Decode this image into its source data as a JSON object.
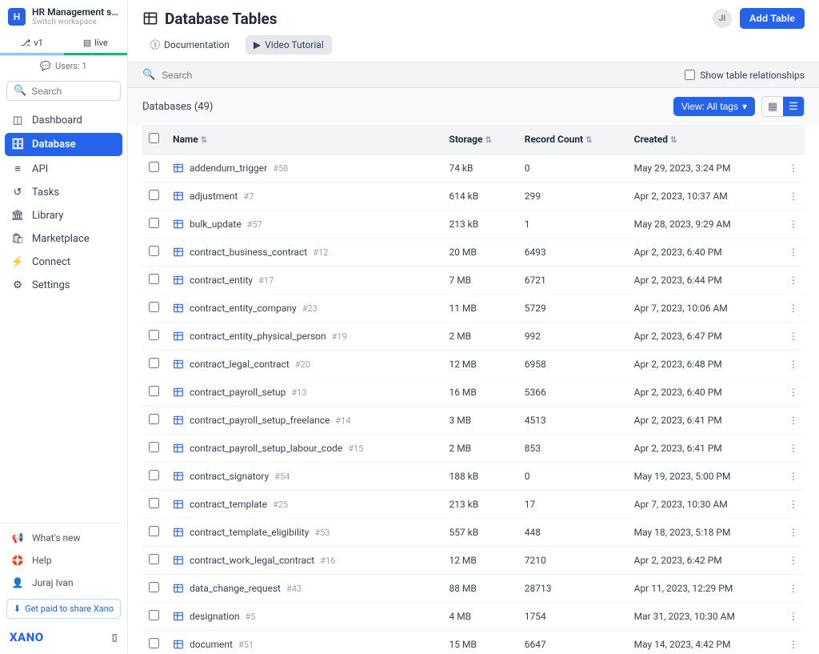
{
  "workspace": {
    "logo_letter": "H",
    "name": "HR Management sy...",
    "subtitle": "Switch workspace"
  },
  "env_tabs": {
    "v1": "v1",
    "live": "live"
  },
  "users_bar": "Users: 1",
  "sidebar_search_placeholder": "Search",
  "nav": {
    "dashboard": "Dashboard",
    "database": "Database",
    "api": "API",
    "tasks": "Tasks",
    "library": "Library",
    "marketplace": "Marketplace",
    "connect": "Connect",
    "settings": "Settings"
  },
  "bottom_nav": {
    "whatsnew": "What's new",
    "help": "Help",
    "user": "Juraj Ivan",
    "share": "Get paid to share Xano",
    "brand": "XANO"
  },
  "header": {
    "title": "Database Tables",
    "documentation": "Documentation",
    "video_tutorial": "Video Tutorial",
    "avatar": "JI",
    "add_table": "Add Table"
  },
  "searchbar": {
    "placeholder": "Search",
    "show_relationships": "Show table relationships"
  },
  "toolbar": {
    "count_label": "Databases (49)",
    "view_btn": "View: All tags"
  },
  "columns": {
    "name": "Name",
    "storage": "Storage",
    "record_count": "Record Count",
    "created": "Created"
  },
  "rows": [
    {
      "name": "addendum_trigger",
      "id": "#58",
      "storage": "74 kB",
      "records": "0",
      "created": "May 29, 2023, 3:24 PM"
    },
    {
      "name": "adjustment",
      "id": "#7",
      "storage": "614 kB",
      "records": "299",
      "created": "Apr 2, 2023, 10:37 AM"
    },
    {
      "name": "bulk_update",
      "id": "#57",
      "storage": "213 kB",
      "records": "1",
      "created": "May 28, 2023, 9:29 AM"
    },
    {
      "name": "contract_business_contract",
      "id": "#12",
      "storage": "20 MB",
      "records": "6493",
      "created": "Apr 2, 2023, 6:40 PM"
    },
    {
      "name": "contract_entity",
      "id": "#17",
      "storage": "7 MB",
      "records": "6721",
      "created": "Apr 2, 2023, 6:44 PM"
    },
    {
      "name": "contract_entity_company",
      "id": "#23",
      "storage": "11 MB",
      "records": "5729",
      "created": "Apr 7, 2023, 10:06 AM"
    },
    {
      "name": "contract_entity_physical_person",
      "id": "#19",
      "storage": "2 MB",
      "records": "992",
      "created": "Apr 2, 2023, 6:47 PM"
    },
    {
      "name": "contract_legal_contract",
      "id": "#20",
      "storage": "12 MB",
      "records": "6958",
      "created": "Apr 2, 2023, 6:48 PM"
    },
    {
      "name": "contract_payroll_setup",
      "id": "#13",
      "storage": "16 MB",
      "records": "5366",
      "created": "Apr 2, 2023, 6:40 PM"
    },
    {
      "name": "contract_payroll_setup_freelance",
      "id": "#14",
      "storage": "3 MB",
      "records": "4513",
      "created": "Apr 2, 2023, 6:41 PM"
    },
    {
      "name": "contract_payroll_setup_labour_code",
      "id": "#15",
      "storage": "2 MB",
      "records": "853",
      "created": "Apr 2, 2023, 6:41 PM"
    },
    {
      "name": "contract_signatory",
      "id": "#54",
      "storage": "188 kB",
      "records": "0",
      "created": "May 19, 2023, 5:00 PM"
    },
    {
      "name": "contract_template",
      "id": "#25",
      "storage": "213 kB",
      "records": "17",
      "created": "Apr 7, 2023, 10:30 AM"
    },
    {
      "name": "contract_template_eligibility",
      "id": "#53",
      "storage": "557 kB",
      "records": "448",
      "created": "May 18, 2023, 5:18 PM"
    },
    {
      "name": "contract_work_legal_contract",
      "id": "#16",
      "storage": "12 MB",
      "records": "7210",
      "created": "Apr 2, 2023, 6:42 PM"
    },
    {
      "name": "data_change_request",
      "id": "#43",
      "storage": "88 MB",
      "records": "28713",
      "created": "Apr 11, 2023, 12:29 PM"
    },
    {
      "name": "designation",
      "id": "#5",
      "storage": "4 MB",
      "records": "1754",
      "created": "Mar 31, 2023, 10:30 AM"
    },
    {
      "name": "document",
      "id": "#51",
      "storage": "15 MB",
      "records": "6647",
      "created": "May 14, 2023, 4:42 PM"
    }
  ]
}
